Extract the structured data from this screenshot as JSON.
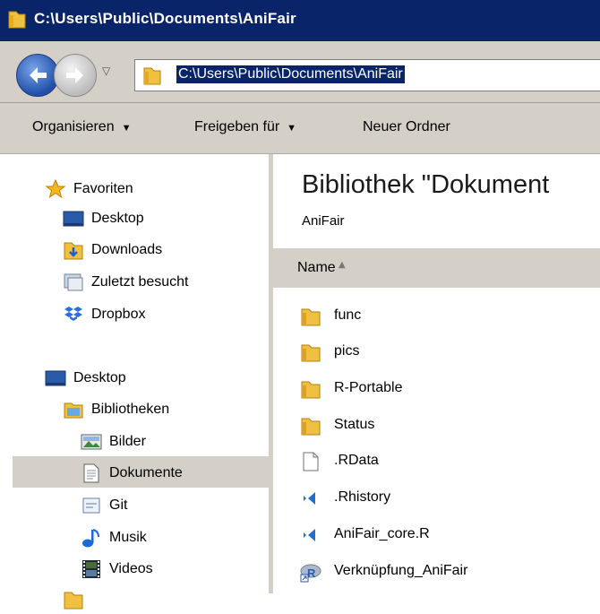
{
  "window": {
    "title": "C:\\Users\\Public\\Documents\\AniFair"
  },
  "address": {
    "path": "C:\\Users\\Public\\Documents\\AniFair"
  },
  "toolbar": {
    "organize": "Organisieren",
    "share": "Freigeben für",
    "new_folder": "Neuer Ordner"
  },
  "nav": {
    "favorites": {
      "label": "Favoriten",
      "items": [
        "Desktop",
        "Downloads",
        "Zuletzt besucht",
        "Dropbox"
      ]
    },
    "desktop": "Desktop",
    "libraries": {
      "label": "Bibliotheken",
      "items": [
        "Bilder",
        "Dokumente",
        "Git",
        "Musik",
        "Videos"
      ]
    },
    "selected": "Dokumente"
  },
  "content": {
    "title": "Bibliothek \"Dokument",
    "subtitle": "AniFair",
    "column_name": "Name",
    "files": [
      {
        "name": "func",
        "icon": "folder-icon"
      },
      {
        "name": "pics",
        "icon": "folder-icon"
      },
      {
        "name": "R-Portable",
        "icon": "folder-icon"
      },
      {
        "name": "Status",
        "icon": "folder-icon"
      },
      {
        "name": ".RData",
        "icon": "file-icon"
      },
      {
        "name": ".Rhistory",
        "icon": "vscode-icon"
      },
      {
        "name": "AniFair_core.R",
        "icon": "vscode-icon"
      },
      {
        "name": "Verknüpfung_AniFair",
        "icon": "r-shortcut-icon"
      }
    ]
  },
  "colors": {
    "title_bar": "#0a246a",
    "chrome": "#d4d0c8",
    "folder": "#e8b830"
  }
}
